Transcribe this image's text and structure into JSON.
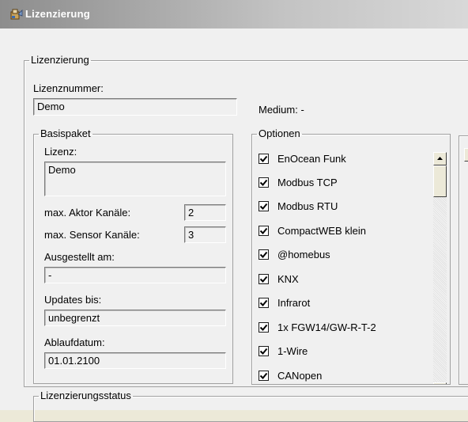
{
  "window": {
    "title": "Lizenzierung",
    "icon": "license-app-icon"
  },
  "lizenzierung_group": {
    "legend": "Lizenzierung",
    "license_number_label": "Lizenznummer:",
    "license_number_value": "Demo",
    "medium_label": "Medium: -"
  },
  "basispaket": {
    "legend": "Basispaket",
    "lizenz_label": "Lizenz:",
    "lizenz_value": "Demo",
    "aktor_label": "max. Aktor Kanäle:",
    "aktor_value": "2",
    "sensor_label": "max. Sensor Kanäle:",
    "sensor_value": "3",
    "ausgestellt_label": "Ausgestellt am:",
    "ausgestellt_value": "-",
    "updates_label": "Updates bis:",
    "updates_value": "unbegrenzt",
    "ablauf_label": "Ablaufdatum:",
    "ablauf_value": "01.01.2100"
  },
  "optionen": {
    "legend": "Optionen",
    "items": [
      {
        "label": "EnOcean Funk",
        "checked": true
      },
      {
        "label": "Modbus TCP",
        "checked": true
      },
      {
        "label": "Modbus RTU",
        "checked": true
      },
      {
        "label": "CompactWEB klein",
        "checked": true
      },
      {
        "label": "@homebus",
        "checked": true
      },
      {
        "label": "KNX",
        "checked": true
      },
      {
        "label": "Infrarot",
        "checked": true
      },
      {
        "label": "1x FGW14/GW-R-T-2",
        "checked": true
      },
      {
        "label": "1-Wire",
        "checked": true
      },
      {
        "label": "CANopen",
        "checked": true
      }
    ]
  },
  "status_group": {
    "legend": "Lizenzierungsstatus"
  },
  "colors": {
    "title_gradient_start": "#8d8d8d",
    "title_gradient_end": "#d8d8d8",
    "window_bg": "#f0f0f0"
  }
}
